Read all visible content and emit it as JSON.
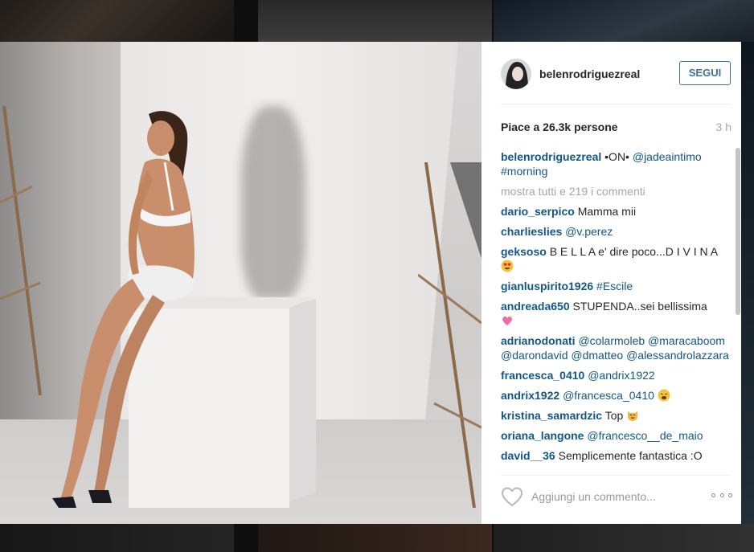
{
  "post": {
    "username": "belenrodriguezreal",
    "follow_label": "SEGUI",
    "likes_text": "Piace a 26.3k persone",
    "time": "3 h",
    "caption": {
      "user": "belenrodriguezreal",
      "text": "•ON•",
      "mention": "@jadeaintimo",
      "hashtag": "#morning"
    },
    "show_all_label": "mostra tutti e 219 i commenti",
    "comments": [
      {
        "user": "dario_serpico",
        "text": "Mamma mii"
      },
      {
        "user": "charlieslies",
        "mention": "@v.perez"
      },
      {
        "user": "geksoso",
        "text": "B E L L A e' dire poco...D I V I N A",
        "emoji": "heart-eyes"
      },
      {
        "user": "gianluspirito1926",
        "mention": "#Escile"
      },
      {
        "user": "andreada650",
        "text": "STUPENDA..sei bellissima",
        "emoji": "sparkling-heart"
      },
      {
        "user": "adrianodonati",
        "mention": "@colarmoleb @maracaboom @darondavid @dmatteo @alessandrolazzara"
      },
      {
        "user": "francesca_0410",
        "mention": "@andrix1922"
      },
      {
        "user": "andrix1922",
        "mention": "@francesca_0410",
        "emoji": "weary-face"
      },
      {
        "user": "kristina_samardzic",
        "text": "Top",
        "emoji": "smiling-cat"
      },
      {
        "user": "oriana_langone",
        "mention": "@francesco__de_maio"
      },
      {
        "user": "david__36",
        "text": "Semplicemente fantastica :O"
      }
    ],
    "comment_placeholder": "Aggiungi un commento...",
    "icons": {
      "like": "heart-outline-icon",
      "more": "more-options-icon"
    },
    "colors": {
      "link": "#125688",
      "follow": "#3f729b",
      "muted": "#a5a7aa"
    }
  }
}
